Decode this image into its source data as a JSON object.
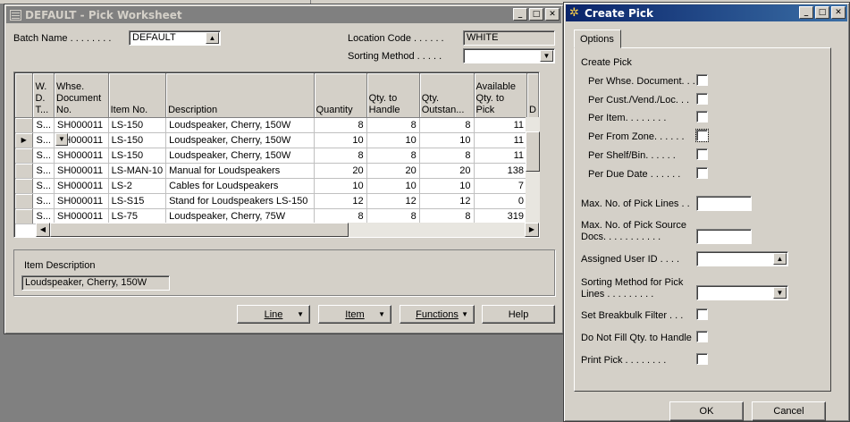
{
  "worksheet": {
    "title": "DEFAULT - Pick Worksheet",
    "batch_name_label": "Batch Name . . . . . . . .",
    "batch_name_value": "DEFAULT",
    "location_code_label": "Location Code . . . . . .",
    "location_code_value": "WHITE",
    "sorting_method_label": "Sorting Method . . . . .",
    "sorting_method_value": "",
    "columns": [
      "W. D. T...",
      "Whse. Document No.",
      "Item No.",
      "Description",
      "Quantity",
      "Qty. to Handle",
      "Qty. Outstan...",
      "Available Qty. to Pick",
      "D"
    ],
    "rows": [
      {
        "type": "S...",
        "doc": "SH000011",
        "item": "LS-150",
        "desc": "Loudspeaker, Cherry, 150W",
        "qty": "8",
        "handle": "8",
        "outstanding": "8",
        "available": "11"
      },
      {
        "type": "S...",
        "doc": "SH000011",
        "item": "LS-150",
        "desc": "Loudspeaker, Cherry, 150W",
        "qty": "10",
        "handle": "10",
        "outstanding": "10",
        "available": "11"
      },
      {
        "type": "S...",
        "doc": "SH000011",
        "item": "LS-150",
        "desc": "Loudspeaker, Cherry, 150W",
        "qty": "8",
        "handle": "8",
        "outstanding": "8",
        "available": "11"
      },
      {
        "type": "S...",
        "doc": "SH000011",
        "item": "LS-MAN-10",
        "desc": "Manual for Loudspeakers",
        "qty": "20",
        "handle": "20",
        "outstanding": "20",
        "available": "138"
      },
      {
        "type": "S...",
        "doc": "SH000011",
        "item": "LS-2",
        "desc": "Cables for Loudspeakers",
        "qty": "10",
        "handle": "10",
        "outstanding": "10",
        "available": "7"
      },
      {
        "type": "S...",
        "doc": "SH000011",
        "item": "LS-S15",
        "desc": "Stand for Loudspeakers LS-150",
        "qty": "12",
        "handle": "12",
        "outstanding": "12",
        "available": "0"
      },
      {
        "type": "S...",
        "doc": "SH000011",
        "item": "LS-75",
        "desc": "Loudspeaker, Cherry, 75W",
        "qty": "8",
        "handle": "8",
        "outstanding": "8",
        "available": "319"
      }
    ],
    "item_description_label": "Item Description",
    "item_description_value": "Loudspeaker, Cherry, 150W",
    "buttons": {
      "line": "Line",
      "item": "Item",
      "functions": "Functions",
      "help": "Help"
    }
  },
  "create_pick": {
    "title": "Create Pick",
    "tab_options": "Options",
    "section_label": "Create Pick",
    "per_whse_document": "Per Whse. Document. . .",
    "per_cust_vend_loc": "Per Cust./Vend./Loc. . .",
    "per_item": "Per Item. . . . . . . .",
    "per_from_zone": "Per From Zone. . . . . .",
    "per_shelf_bin": "Per Shelf/Bin. . . . . .",
    "per_due_date": "Per Due Date . . . . . .",
    "max_pick_lines_label": "Max. No. of Pick Lines . .",
    "max_pick_lines_value": "",
    "max_source_docs_label_1": "Max. No. of Pick Source",
    "max_source_docs_label_2": "Docs. . . . . . . . . . .",
    "max_source_docs_value": "",
    "assigned_user_id_label": "Assigned User ID . . . .",
    "assigned_user_id_value": "",
    "sorting_method_label_1": "Sorting Method for Pick",
    "sorting_method_label_2": "Lines . . . . . . . . .",
    "sorting_method_value": "",
    "set_breakbulk_filter": "Set Breakbulk Filter . . .",
    "do_not_fill_qty": "Do Not Fill Qty. to Handle",
    "print_pick": "Print Pick . . . . . . . .",
    "ok": "OK",
    "cancel": "Cancel"
  }
}
